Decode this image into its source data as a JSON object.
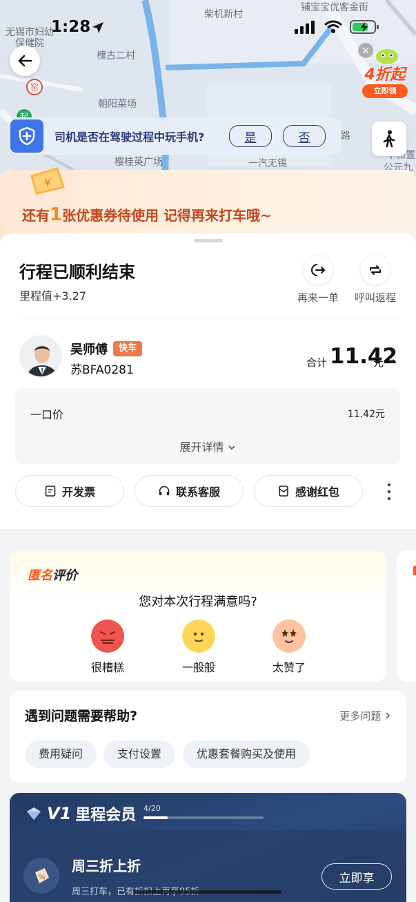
{
  "status_bar": {
    "time": "1:28"
  },
  "map": {
    "labels": [
      "无锡市妇幼",
      "保健院",
      "柴机新村",
      "铺宝宝优客金街",
      "槐古二村",
      "朝阳菜场",
      "窑",
      "起",
      "樱桂英广场",
      "一汽无锡",
      "路",
      "中和置",
      "公元九"
    ]
  },
  "promo": {
    "big": "4折起",
    "cta": "立即领",
    "close": "×"
  },
  "safety_question": {
    "text": "司机是否在驾驶过程中玩手机?",
    "yes": "是",
    "no": "否"
  },
  "coupon": {
    "prefix": "还有",
    "count": "1",
    "suffix": "张优惠券待使用 记得再来打车哦~"
  },
  "trip": {
    "title": "行程已顺利结束",
    "mileage": "里程值+3.27",
    "again_label": "再来一单",
    "return_label": "呼叫返程"
  },
  "driver": {
    "name": "吴师傅",
    "car_type": "快车",
    "plate": "苏BFA0281"
  },
  "fare": {
    "total_label": "合计",
    "total": "11.42",
    "unit": "元",
    "item_name": "一口价",
    "item_value": "11.42元",
    "expand": "展开详情"
  },
  "actions": {
    "invoice": "开发票",
    "service": "联系客服",
    "thanks": "感谢红包"
  },
  "rating": {
    "anon_a": "匿名",
    "anon_b": "评价",
    "question": "您对本次行程满意吗?",
    "bad": "很糟糕",
    "ok": "一般般",
    "great": "太赞了"
  },
  "help": {
    "title": "遇到问题需要帮助?",
    "more": "更多问题",
    "chips": [
      "费用疑问",
      "支付设置",
      "优惠套餐购买及使用"
    ]
  },
  "member": {
    "v1": "V1",
    "title": "里程会员",
    "progress_text": "4/20",
    "progress": 0.2,
    "offer": "周三折上折",
    "desc": "周三打车，已有折扣上再享95折",
    "cta": "立即享"
  },
  "colors": {
    "accent_orange": "#ff5a1f",
    "brand_blue": "#3f73e8",
    "member_navy": "#233a63"
  }
}
